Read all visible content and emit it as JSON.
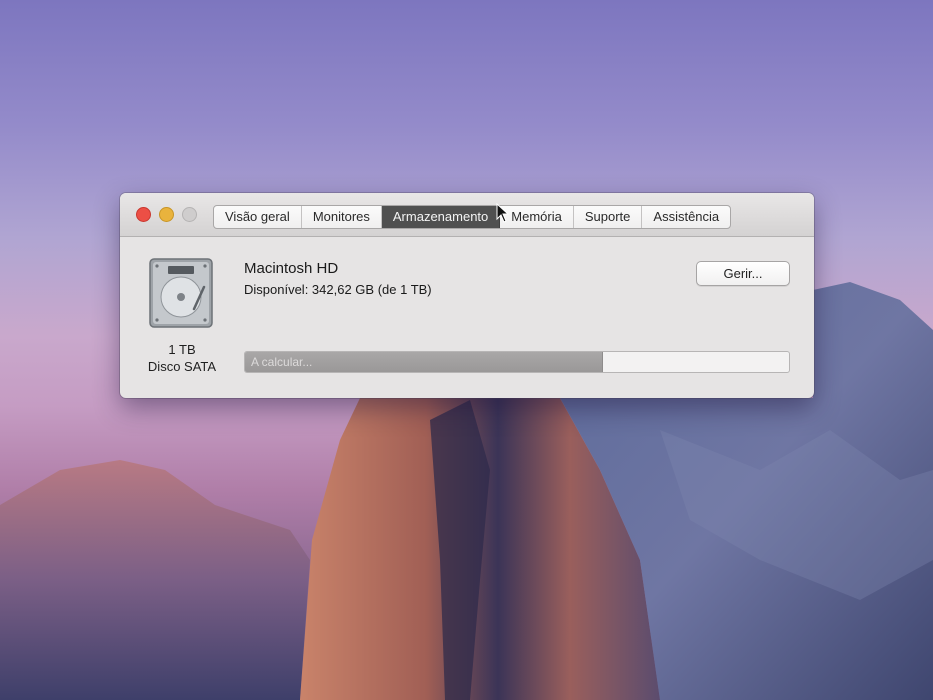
{
  "window": {
    "tabs": [
      {
        "label": "Visão geral",
        "active": false
      },
      {
        "label": "Monitores",
        "active": false
      },
      {
        "label": "Armazenamento",
        "active": true
      },
      {
        "label": "Memória",
        "active": false
      },
      {
        "label": "Suporte",
        "active": false
      },
      {
        "label": "Assistência",
        "active": false
      }
    ],
    "traffic_lights": {
      "close": "#ec4f45",
      "minimize": "#e9b33d",
      "zoom": "#cfcdcd"
    }
  },
  "drive": {
    "icon": "hard-drive-icon",
    "size": "1 TB",
    "type": "Disco SATA"
  },
  "disk": {
    "name": "Macintosh HD",
    "available": "Disponível: 342,62 GB (de 1 TB)",
    "bar_label": "A calcular...",
    "used_fraction": 0.657
  },
  "actions": {
    "manage_label": "Gerir..."
  },
  "colors": {
    "active_tab": "#505050",
    "window_bg": "#e6e4e4"
  }
}
